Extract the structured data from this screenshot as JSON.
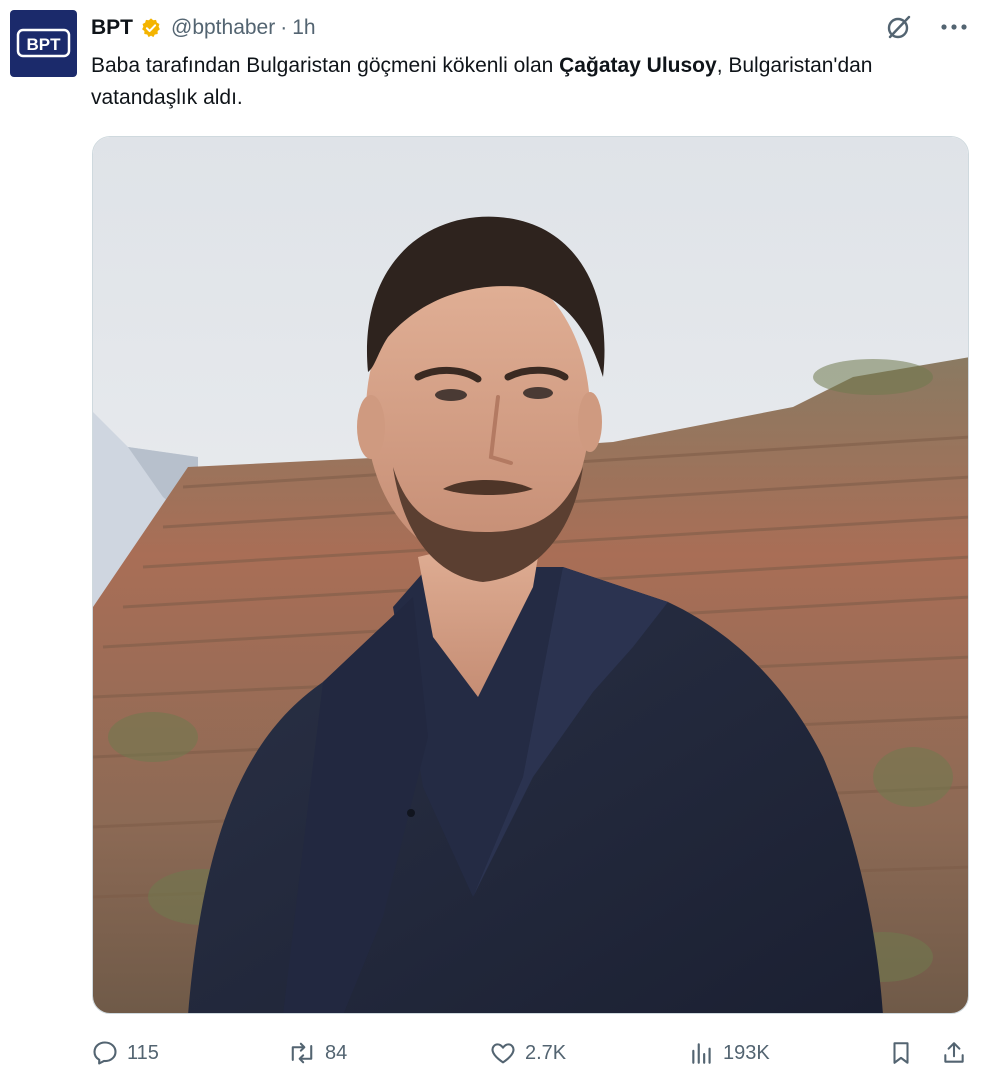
{
  "account": {
    "name": "BPT",
    "handle": "@bpthaber",
    "separator": "·",
    "time": "1h",
    "avatar_text": "BPT",
    "verified_color": "#f4b400"
  },
  "tweet": {
    "text_part1": "Baba tarafından Bulgaristan göçmeni kökenli olan ",
    "text_bold": "Çağatay Ulusoy",
    "text_part2": ", Bulgaristan'dan vatandaşlık aldı."
  },
  "top_actions": {
    "grok_icon": "grok-icon",
    "more_icon": "more-icon"
  },
  "stats": {
    "replies": "115",
    "reposts": "84",
    "likes": "2.7K",
    "views": "193K"
  },
  "colors": {
    "text": "#0f1419",
    "muted": "#536471",
    "avatar_bg": "#1b2a6b"
  }
}
